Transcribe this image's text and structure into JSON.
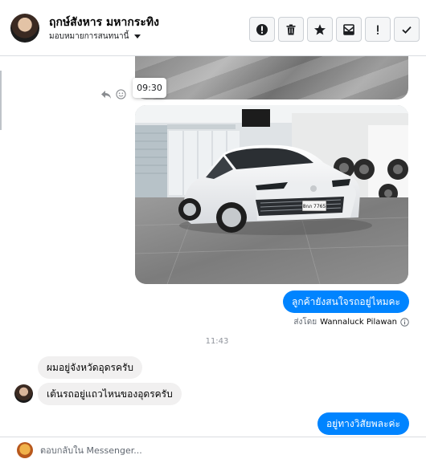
{
  "header": {
    "contact_name": "ฤกษ์สังหาร มหากระทิง",
    "assign_label": "มอบหมายการสนทนานี้",
    "actions": [
      {
        "name": "report-button",
        "icon": "exclamation-circle-icon"
      },
      {
        "name": "delete-button",
        "icon": "trash-icon"
      },
      {
        "name": "star-button",
        "icon": "star-icon"
      },
      {
        "name": "mark-unread-button",
        "icon": "mail-icon"
      },
      {
        "name": "important-button",
        "icon": "exclamation-icon"
      },
      {
        "name": "done-button",
        "icon": "check-icon"
      }
    ]
  },
  "thread": {
    "hover_time": "09:30",
    "outgoing_question": "ลูกค้ายังสนใจรถอยู่ไหมคะ",
    "sent_by_label": "ส่งโดย",
    "sent_by_name": "Wannaluck Pilawan",
    "time_divider": "11:43",
    "incoming": [
      "ผมอยู่จังหวัดอุดรครับ",
      "เต้นรถอยู่แถวไหนของอุดรครับ"
    ],
    "outgoing_reply": "อยู่ทางวิสัยพละค่ะ",
    "car_plate": "8กภ 7765"
  },
  "composer": {
    "placeholder": "ตอบกลับใน Messenger..."
  },
  "colors": {
    "outgoing_bubble": "#0084ff",
    "incoming_bubble": "#f1f0f0",
    "border": "#dadde1"
  }
}
